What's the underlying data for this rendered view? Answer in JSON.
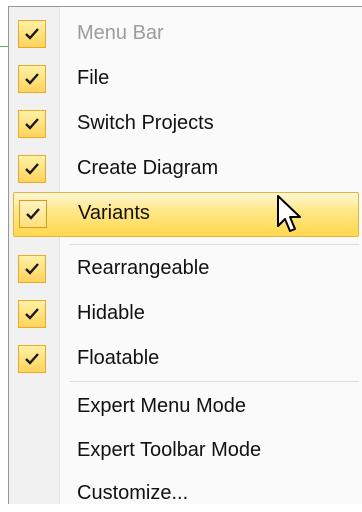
{
  "menu": {
    "checked_items": [
      {
        "label": "Menu Bar",
        "checked": true,
        "enabled": false
      },
      {
        "label": "File",
        "checked": true,
        "enabled": true
      },
      {
        "label": "Switch Projects",
        "checked": true,
        "enabled": true
      },
      {
        "label": "Create Diagram",
        "checked": true,
        "enabled": true
      },
      {
        "label": "Variants",
        "checked": true,
        "enabled": true,
        "highlighted": true
      }
    ],
    "option_items": [
      {
        "label": "Rearrangeable",
        "checked": true
      },
      {
        "label": "Hidable",
        "checked": true
      },
      {
        "label": "Floatable",
        "checked": true
      }
    ],
    "mode_items": [
      {
        "label": "Expert Menu Mode"
      },
      {
        "label": "Expert Toolbar Mode"
      },
      {
        "label": "Customize..."
      }
    ]
  },
  "colors": {
    "highlight": "#ffe889",
    "check_background": "#ffd35a",
    "disabled_text": "#9c9c9c"
  },
  "icons": {
    "check": "checkmark-icon",
    "cursor": "arrow-cursor-icon"
  }
}
